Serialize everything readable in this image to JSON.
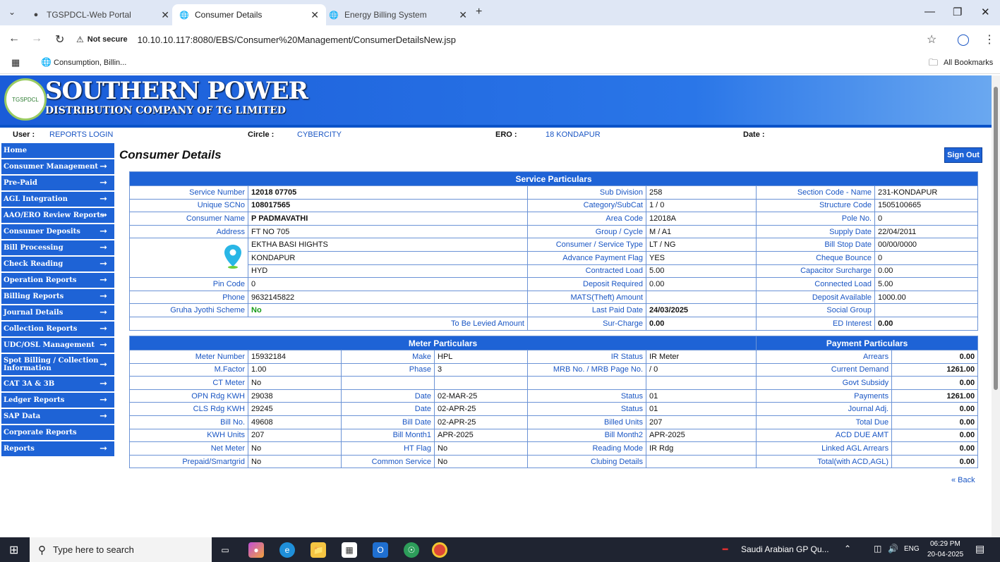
{
  "browser": {
    "tabs": [
      {
        "label": "TGSPDCL-Web Portal"
      },
      {
        "label": "Consumer Details"
      },
      {
        "label": "Energy Billing System"
      }
    ],
    "security": "Not secure",
    "url": "10.10.10.117:8080/EBS/Consumer%20Management/ConsumerDetailsNew.jsp",
    "bookmark": "Consumption, Billin...",
    "all_bookmarks": "All Bookmarks"
  },
  "banner": {
    "line1": "SOUTHERN POWER",
    "line2": "DISTRIBUTION COMPANY OF TG LIMITED",
    "logo_text": "TGSPDCL"
  },
  "userbar": {
    "user_label": "User :",
    "user": "REPORTS LOGIN",
    "circle_label": "Circle :",
    "circle": "CYBERCITY",
    "ero_label": "ERO :",
    "ero": "18 KONDAPUR",
    "date_label": "Date :"
  },
  "sidebar": [
    "Home",
    "Consumer Management",
    "Pre-Paid",
    "AGL Integration",
    "AAO/ERO Review Reports",
    "Consumer Deposits",
    "Bill Processing",
    "Check Reading",
    "Operation Reports",
    "Billing Reports",
    "Journal Details",
    "Collection Reports",
    "UDC/OSL Management",
    "Spot Billing / Collection Information",
    "CAT 3A & 3B",
    "Ledger Reports",
    "SAP Data",
    "Corporate Reports",
    "Reports"
  ],
  "page": {
    "title": "Consumer Details",
    "sign_out": "Sign Out",
    "back": "« Back"
  },
  "service": {
    "header": "Service Particulars",
    "c1": {
      "service_number_l": "Service Number",
      "service_number": "12018 07705",
      "unique_l": "Unique SCNo",
      "unique": "108017565",
      "name_l": "Consumer Name",
      "name": "P PADMAVATHI",
      "address_l": "Address",
      "addr1": "FT NO 705",
      "addr2": "EKTHA BASI HIGHTS",
      "addr3": "KONDAPUR",
      "addr4": "HYD",
      "pin_l": "Pin Code",
      "pin": "0",
      "phone_l": "Phone",
      "phone": "9632145822",
      "gruha_l": "Gruha Jyothi Scheme",
      "gruha": "No",
      "levied_l": "To Be Levied Amount"
    },
    "c2": {
      "subdiv_l": "Sub Division",
      "subdiv": "258",
      "cat_l": "Category/SubCat",
      "cat": "1 / 0",
      "area_l": "Area Code",
      "area": "12018A",
      "group_l": "Group / Cycle",
      "group": "M / A1",
      "ctype_l": "Consumer / Service Type",
      "ctype": "LT / NG",
      "adv_l": "Advance Payment Flag",
      "adv": "YES",
      "cload_l": "Contracted Load",
      "cload": "5.00",
      "dep_l": "Deposit Required",
      "dep": "0.00",
      "mats_l": "MATS(Theft) Amount",
      "mats": "",
      "lpd_l": "Last Paid Date",
      "lpd": "24/03/2025",
      "sur_l": "Sur-Charge",
      "sur": "0.00"
    },
    "c3": {
      "sec_l": "Section Code - Name",
      "sec": "231-KONDAPUR",
      "struct_l": "Structure Code",
      "struct": "1505100665",
      "pole_l": "Pole No.",
      "pole": "0",
      "supply_l": "Supply Date",
      "supply": "22/04/2011",
      "bstop_l": "Bill Stop Date",
      "bstop": "00/00/0000",
      "cheque_l": "Cheque Bounce",
      "cheque": "0",
      "cap_l": "Capacitor Surcharge",
      "cap": "0.00",
      "conn_l": "Connected Load",
      "conn": "5.00",
      "davail_l": "Deposit Available",
      "davail": "1000.00",
      "social_l": "Social Group",
      "social": "",
      "ed_l": "ED Interest",
      "ed": "0.00"
    }
  },
  "meter": {
    "header": "Meter Particulars",
    "pay_header": "Payment Particulars",
    "rows": [
      [
        "Meter Number",
        "15932184",
        "Make",
        "HPL",
        "IR Status",
        "IR Meter",
        "Arrears",
        "0.00"
      ],
      [
        "M.Factor",
        "1.00",
        "Phase",
        "3",
        "MRB No. / MRB Page No.",
        " / 0",
        "Current Demand",
        "1261.00"
      ],
      [
        "CT Meter",
        "No",
        "",
        "",
        "",
        "",
        "Govt Subsidy",
        "0.00"
      ],
      [
        "OPN Rdg KWH",
        "29038",
        "Date",
        "02-MAR-25",
        "Status",
        "01",
        "Payments",
        "1261.00"
      ],
      [
        "CLS Rdg KWH",
        "29245",
        "Date",
        "02-APR-25",
        "Status",
        "01",
        "Journal Adj.",
        "0.00"
      ],
      [
        "Bill No.",
        "49608",
        "Bill Date",
        "02-APR-25",
        "Billed Units",
        "207",
        "Total Due",
        "0.00"
      ],
      [
        "KWH Units",
        "207",
        "Bill Month1",
        "APR-2025",
        "Bill Month2",
        "APR-2025",
        "ACD DUE AMT",
        "0.00"
      ],
      [
        "Net Meter",
        "No",
        "HT Flag",
        "No",
        "Reading Mode",
        "IR Rdg",
        "Linked AGL Arrears",
        "0.00"
      ],
      [
        "Prepaid/Smartgrid",
        "No",
        "Common Service",
        "No",
        "Clubing Details",
        "",
        "Total(with ACD,AGL)",
        "0.00"
      ]
    ]
  },
  "taskbar": {
    "search": "Type here to search",
    "news": "Saudi Arabian GP Qu...",
    "lang": "ENG",
    "time": "06:29 PM",
    "date": "20-04-2025"
  }
}
